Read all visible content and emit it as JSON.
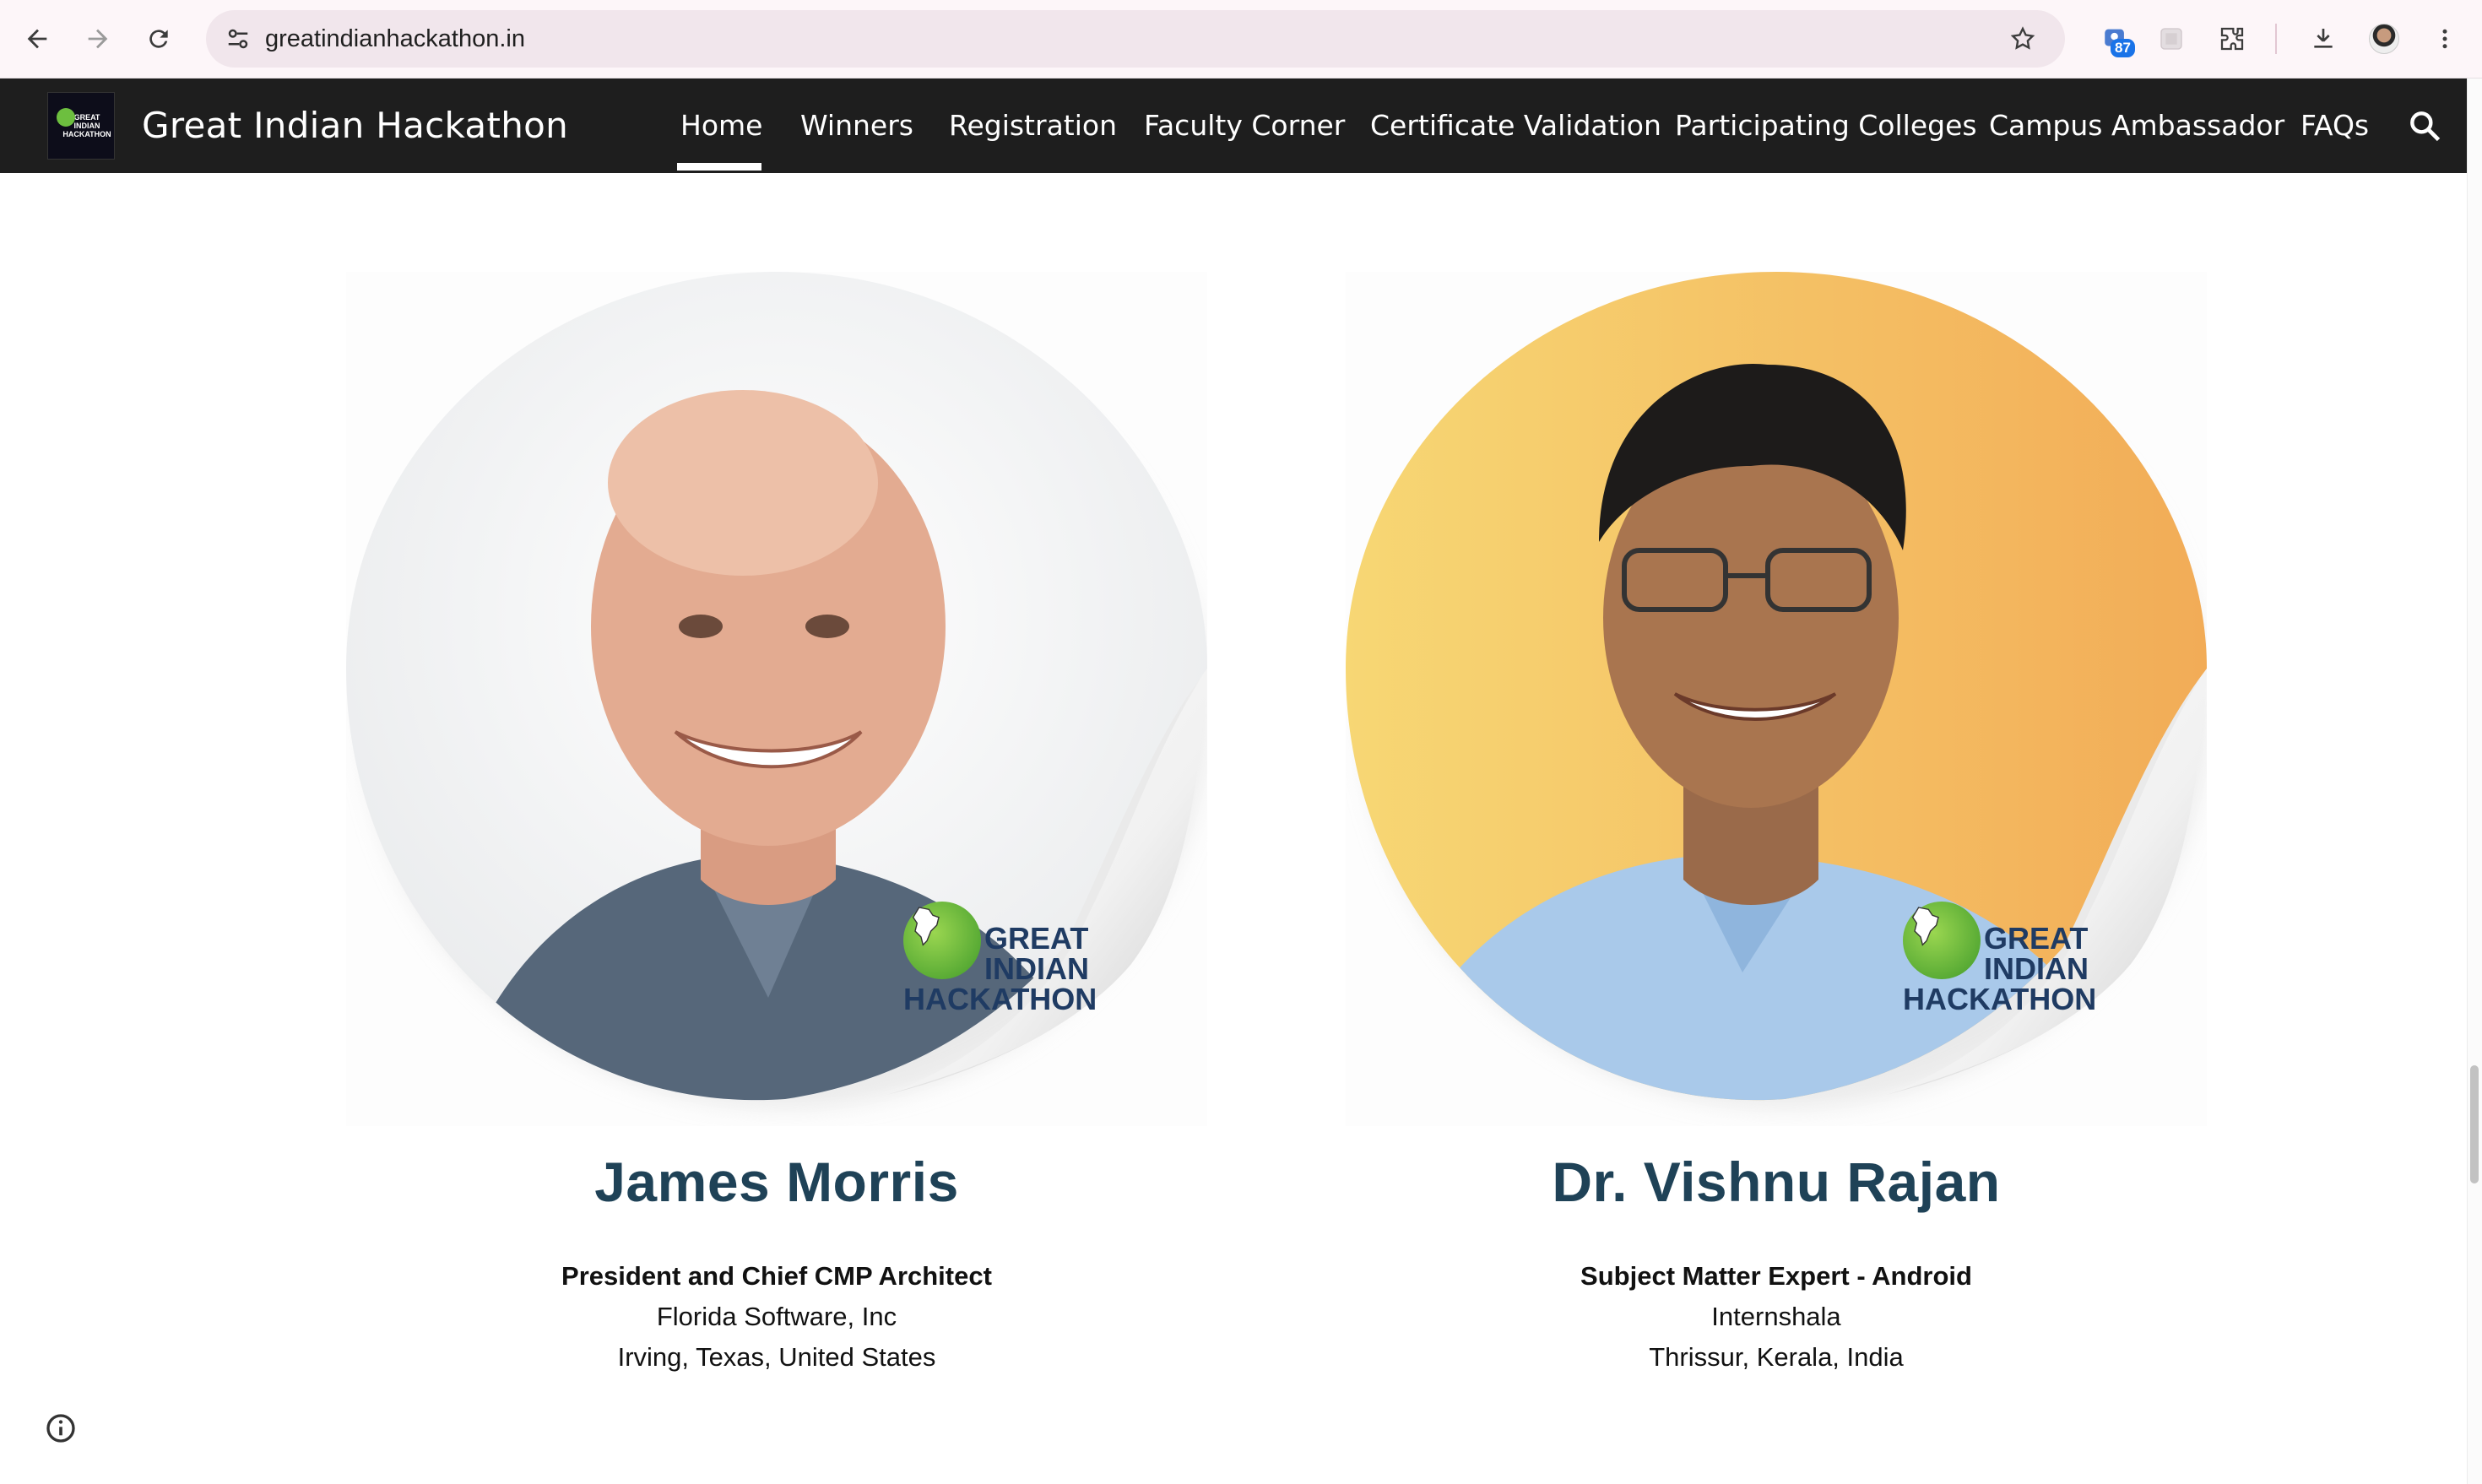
{
  "browser": {
    "url": "greatindianhackathon.in",
    "extension_badge": "87"
  },
  "site": {
    "title": "Great Indian Hackathon",
    "logo_text": "GREAT INDIAN HACKATHON",
    "nav": [
      {
        "label": "Home",
        "active": true
      },
      {
        "label": "Winners"
      },
      {
        "label": "Registration"
      },
      {
        "label": "Faculty Corner"
      },
      {
        "label": "Certificate Validation"
      },
      {
        "label": "Participating Colleges"
      },
      {
        "label": "Campus Ambassador"
      },
      {
        "label": "FAQs"
      }
    ]
  },
  "speakers": [
    {
      "name": "James Morris",
      "role": "President and Chief CMP Architect",
      "org": "Florida Software, Inc",
      "location": "Irving, Texas, United States",
      "sticker_text": [
        "GREAT",
        "INDIAN",
        "HACKATHON"
      ]
    },
    {
      "name": "Dr. Vishnu Rajan",
      "role": "Subject Matter Expert - Android",
      "org": "Internshala",
      "location": "Thrissur, Kerala, India",
      "sticker_text": [
        "GREAT",
        "INDIAN",
        "HACKATHON"
      ]
    }
  ],
  "colors": {
    "nav_bg": "#1e1e1e",
    "name_color": "#1f4257",
    "logo_text_color": "#1f3b63",
    "logo_green": "#5fb33a"
  }
}
